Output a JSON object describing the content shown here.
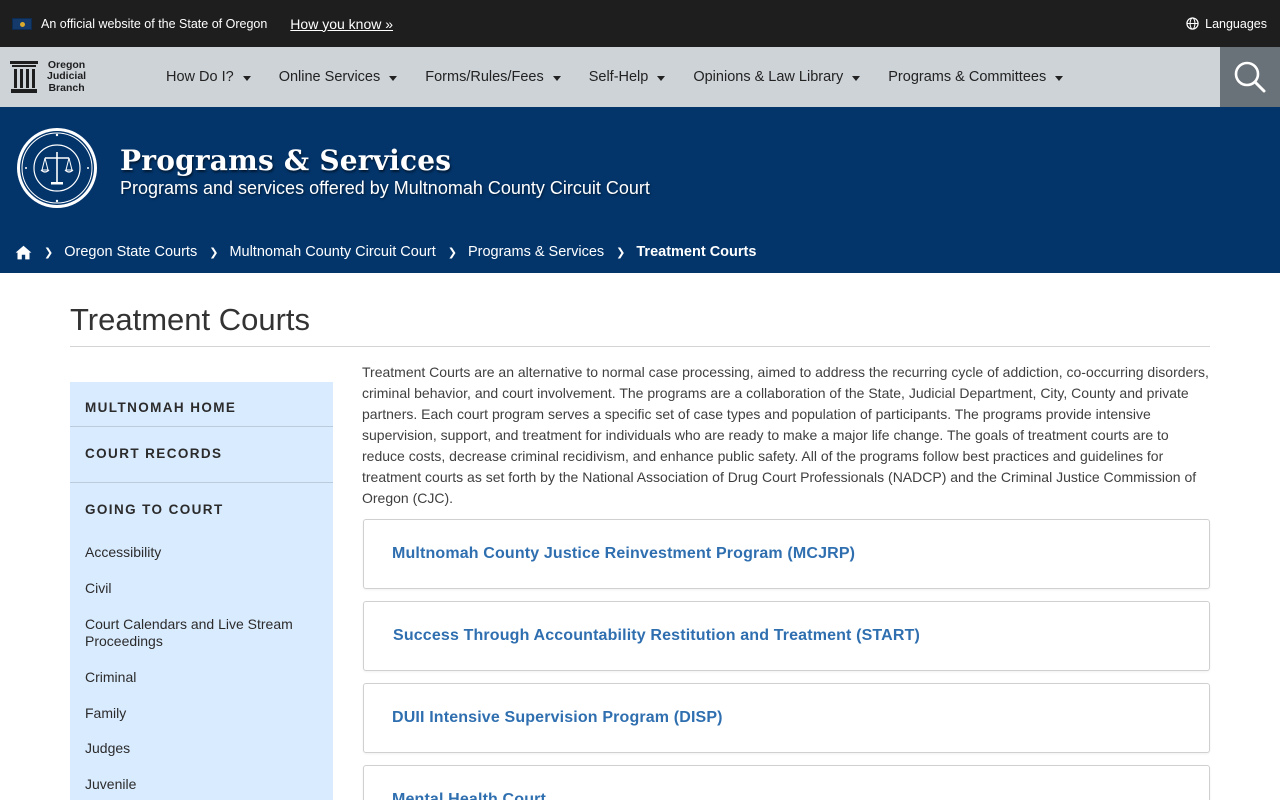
{
  "gov_banner": {
    "official_text": "An official website of the State of Oregon",
    "how_you_know": "How you know »",
    "languages": "Languages"
  },
  "brand": {
    "line1": "Oregon",
    "line2": "Judicial",
    "line3": "Branch"
  },
  "nav": {
    "items": [
      {
        "label": "How Do I?"
      },
      {
        "label": "Online Services"
      },
      {
        "label": "Forms/Rules/Fees"
      },
      {
        "label": "Self-Help"
      },
      {
        "label": "Opinions & Law Library"
      },
      {
        "label": "Programs & Committees"
      }
    ]
  },
  "hero": {
    "title": "Programs & Services",
    "subtitle": "Programs and services offered by Multnomah County Circuit Court"
  },
  "breadcrumb": {
    "items": [
      {
        "label": "Oregon State Courts"
      },
      {
        "label": "Multnomah County Circuit Court"
      },
      {
        "label": "Programs & Services"
      }
    ],
    "current": "Treatment Courts"
  },
  "page": {
    "title": "Treatment Courts",
    "intro": "Treatment Courts are an alternative to normal case processing, aimed to address the recurring cycle of addiction, co-occurring disorders, criminal behavior, and court involvement. The programs are a collaboration of the State, Judicial Department, City, County and private partners. Each court program serves a specific set of case types and population of participants. The programs provide intensive supervision, support, and treatment for individuals who are ready to make a major life change. The goals of treatment courts are to reduce costs, decrease criminal recidivism, and enhance public safety. All of the programs follow best practices and guidelines for treatment courts as set forth by the National Association of Drug Court Professionals (NADCP) and the Criminal Justice Commission of Oregon (CJC)."
  },
  "sidenav": {
    "head1": "MULTNOMAH HOME",
    "head2": "COURT RECORDS",
    "head3": "GOING TO COURT",
    "links": [
      {
        "label": "Accessibility"
      },
      {
        "label": "Civil"
      },
      {
        "label": "Court Calendars and Live Stream Proceedings"
      },
      {
        "label": "Criminal"
      },
      {
        "label": "Family"
      },
      {
        "label": "Judges"
      },
      {
        "label": "Juvenile"
      }
    ]
  },
  "programs": [
    {
      "label": "Multnomah County Justice Reinvestment Program (MCJRP)"
    },
    {
      "label": "Success Through Accountability Restitution and Treatment (START)"
    },
    {
      "label": "DUII Intensive Supervision Program (DISP)"
    },
    {
      "label": "Mental Health Court"
    }
  ],
  "colors": {
    "banner_bg": "#1e1e1e",
    "nav_bg": "#ced3d8",
    "hero_bg": "#03356b",
    "sidenav_bg": "#d9ebff",
    "link": "#2f6fb0"
  }
}
